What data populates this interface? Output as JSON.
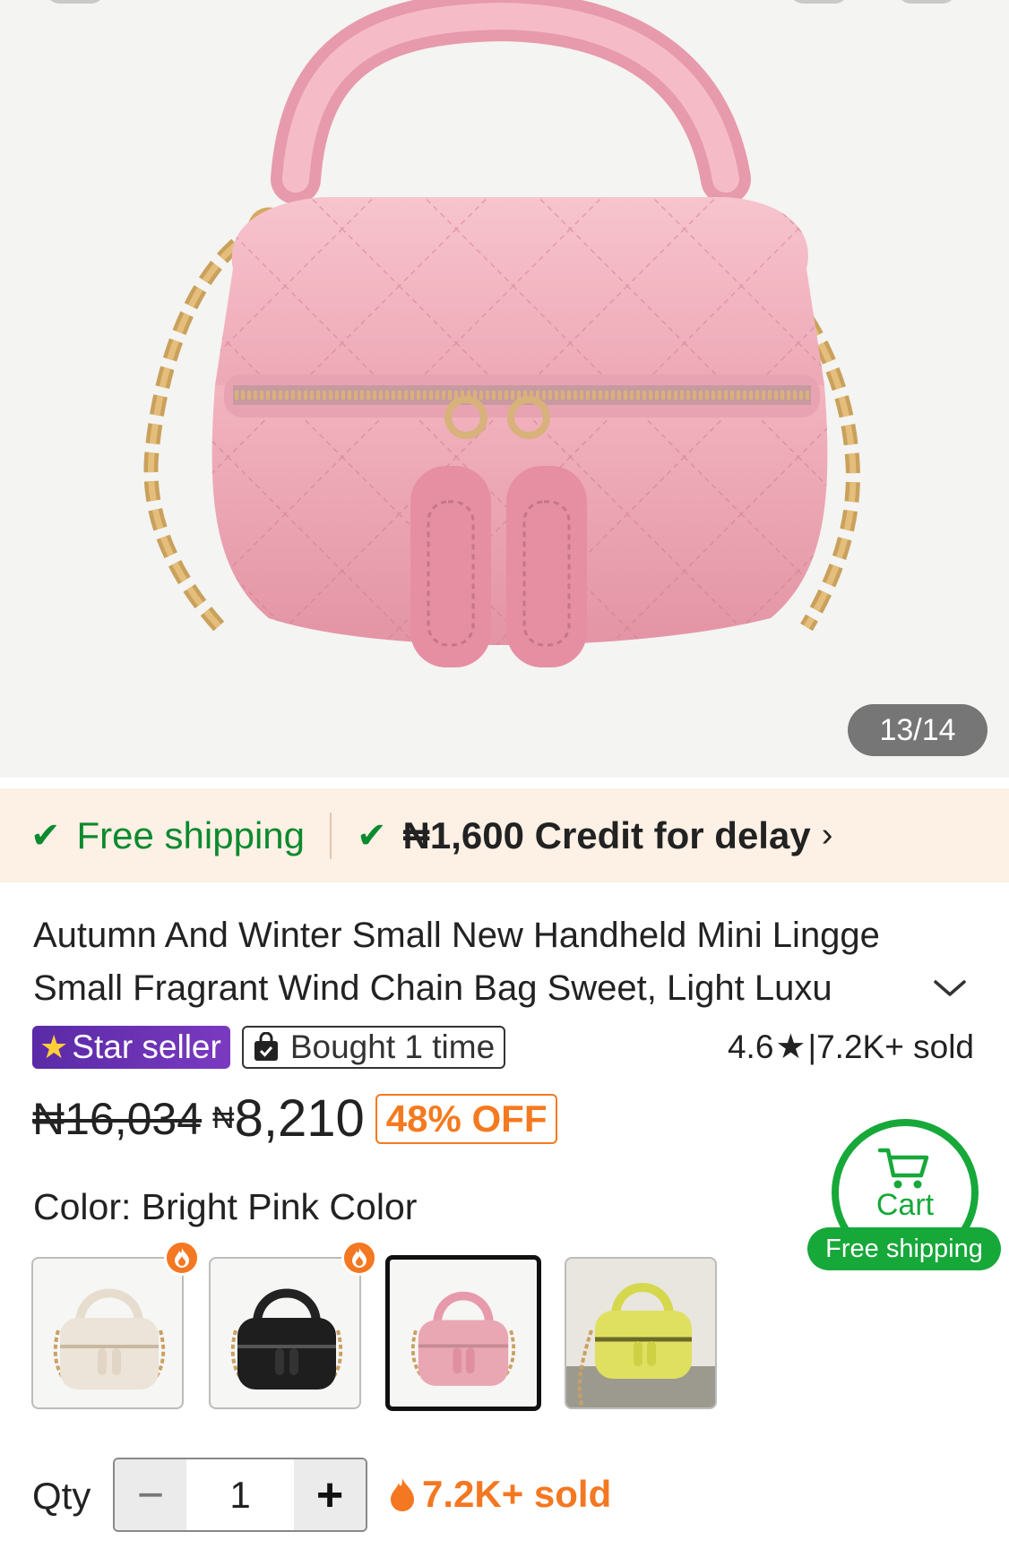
{
  "gallery": {
    "counter": "13/14"
  },
  "shipping_banner": {
    "free_shipping": "Free shipping",
    "credit_for_delay": "₦1,600 Credit for delay",
    "check_icon": "check-icon",
    "colors": {
      "green": "#0b8a2e",
      "background": "#fdf0e5"
    }
  },
  "product": {
    "title_line1": "Autumn And Winter Small New Handheld Mini Lingge",
    "title_line2": "Small Fragrant Wind Chain Bag Sweet, Light Luxu",
    "badges": {
      "star_seller": "Star seller",
      "bought": "Bought 1 time"
    },
    "rating": "4.6",
    "sold_summary": "7.2K+ sold",
    "price": {
      "original": "₦16,034",
      "currency": "₦",
      "current": "8,210",
      "discount": "48% OFF"
    },
    "color": {
      "label": "Color:",
      "selected": "Bright Pink Color",
      "options": [
        {
          "name": "cream",
          "hex": "#ece4d8",
          "hot": true
        },
        {
          "name": "black",
          "hex": "#1e1e1e",
          "hot": true
        },
        {
          "name": "pink",
          "hex": "#e9a6b3",
          "hot": false
        },
        {
          "name": "yellow",
          "hex": "#dfe060",
          "hot": false
        }
      ]
    },
    "quantity": {
      "label": "Qty",
      "value": "1",
      "minus": "−",
      "plus": "+"
    },
    "sold_hot": "7.2K+ sold"
  },
  "cart": {
    "label": "Cart",
    "badge": "Free shipping",
    "color": "#17a83a"
  }
}
